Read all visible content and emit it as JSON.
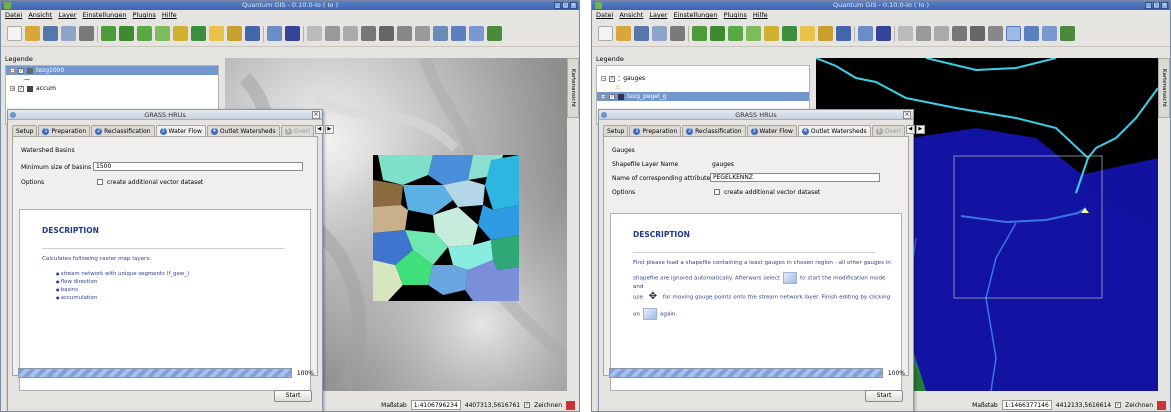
{
  "colors": {
    "titlebar": "#4a72bb",
    "dialog_desc": "#1f3a8a",
    "link_text": "#2f3f8c",
    "progress": "#7fa0d8"
  },
  "left": {
    "window_title": "Quantum GIS - 0.10.0-Io ( Io )",
    "menu": [
      "Datei",
      "Ansicht",
      "Layer",
      "Einstellungen",
      "Plugins",
      "Hilfe"
    ],
    "panel_title": "Legende",
    "side_tab": "Kartenansicht",
    "legend": [
      {
        "label": "tezg1000",
        "selected": true,
        "sub": "—"
      },
      {
        "label": "accum",
        "selected": false
      }
    ],
    "dialog": {
      "title": "GRASS HRUs",
      "tabs": [
        {
          "num": "",
          "label": "Setup"
        },
        {
          "num": "1",
          "label": "Preparation"
        },
        {
          "num": "2",
          "label": "Reclassification"
        },
        {
          "num": "3",
          "label": "Water Flow",
          "active": true
        },
        {
          "num": "4",
          "label": "Outlet Watersheds"
        },
        {
          "num": "5",
          "label": "Overl",
          "dim": true
        }
      ],
      "section": "Watershed Basins",
      "min_size_label": "Minimum size of basins",
      "min_size_value": "1500",
      "options_label": "Options",
      "checkbox_label": "create additional vector dataset",
      "desc_title": "DESCRIPTION",
      "desc_intro": "Calculates following raster map layers:",
      "desc_items": [
        "stream network with unique segments (f_gew_)",
        "flow direction",
        "basins",
        "accumulation"
      ],
      "progress": "100%",
      "start": "Start"
    },
    "status": {
      "scale_label": "Maßstab",
      "scale_value": "1:4106796234",
      "coords": "4407313,5616761",
      "render_label": "Zeichnen"
    }
  },
  "right": {
    "window_title": "Quantum GIS - 0.10.0-Io ( Io )",
    "menu": [
      "Datei",
      "Ansicht",
      "Layer",
      "Einstellungen",
      "Plugins",
      "Hilfe"
    ],
    "panel_title": "Legende",
    "side_tab": "Kartenansicht",
    "legend": [
      {
        "label": "gauges",
        "selected": false
      },
      {
        "label": "tezg_pegel_g",
        "selected": true
      }
    ],
    "dialog": {
      "title": "GRASS HRUs",
      "tabs": [
        {
          "num": "",
          "label": "Setup"
        },
        {
          "num": "1",
          "label": "Preparation"
        },
        {
          "num": "2",
          "label": "Reclassification"
        },
        {
          "num": "3",
          "label": "Water Flow"
        },
        {
          "num": "4",
          "label": "Outlet Watersheds",
          "active": true
        },
        {
          "num": "5",
          "label": "Overl",
          "dim": true
        }
      ],
      "section": "Gauges",
      "shp_label": "Shapefile Layer Name",
      "shp_value": "gauges",
      "attr_label": "Name of corresponding attribute (ID)",
      "attr_value": "PEGELKENNZ",
      "options_label": "Options",
      "checkbox_label": "create additional vector dataset",
      "desc_title": "DESCRIPTION",
      "desc_p1": "First please load a shapefile containing a least gauges in chosen region - all other gauges in",
      "desc_p2a": "shapefile are ignored automatically. Afterwars select",
      "desc_p2b": "to start the modification mode and",
      "desc_p3a": "use",
      "desc_p3b": "for moving gauge points onto the stream network layer. Finish editing by clicking",
      "desc_p4a": "on",
      "desc_p4b": "again.",
      "progress": "100%",
      "start": "Start"
    },
    "status": {
      "scale_label": "Maßstab",
      "scale_value": "1:1466377146",
      "coords": "4412133,5616614",
      "render_label": "Zeichnen"
    }
  }
}
